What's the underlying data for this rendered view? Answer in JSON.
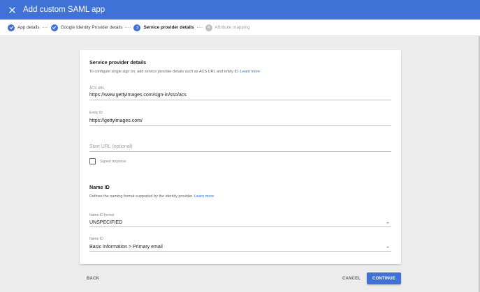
{
  "header": {
    "title": "Add custom SAML app",
    "close_icon": "close-icon",
    "bg_color": "#3f71d6"
  },
  "stepper": {
    "steps": [
      {
        "label": "App details",
        "state": "done"
      },
      {
        "label": "Google Identity Provider details",
        "state": "done"
      },
      {
        "number": "3",
        "label": "Service provider details",
        "state": "active"
      },
      {
        "number": "4",
        "label": "Attribute mapping",
        "state": "inactive"
      }
    ]
  },
  "service_provider": {
    "title": "Service provider details",
    "description": "To configure single sign on, add service provider details such as ACS URL and entity ID.",
    "learn_more": "Learn more",
    "acs_url_label": "ACS URL",
    "acs_url_value": "https://www.gettyimages.com/sign-in/sso/acs",
    "entity_id_label": "Entity ID",
    "entity_id_value": "https://gettyimages.com/",
    "start_url_placeholder": "Start URL (optional)",
    "signed_response_label": "Signed response",
    "signed_response_checked": false
  },
  "name_id": {
    "title": "Name ID",
    "description": "Defines the naming format supported by the identity provider.",
    "learn_more": "Learn more",
    "format_label": "Name ID format",
    "format_value": "UNSPECIFIED",
    "name_id_label": "Name ID",
    "name_id_value": "Basic Information > Primary email"
  },
  "footer": {
    "back": "BACK",
    "cancel": "CANCEL",
    "continue": "CONTINUE"
  }
}
